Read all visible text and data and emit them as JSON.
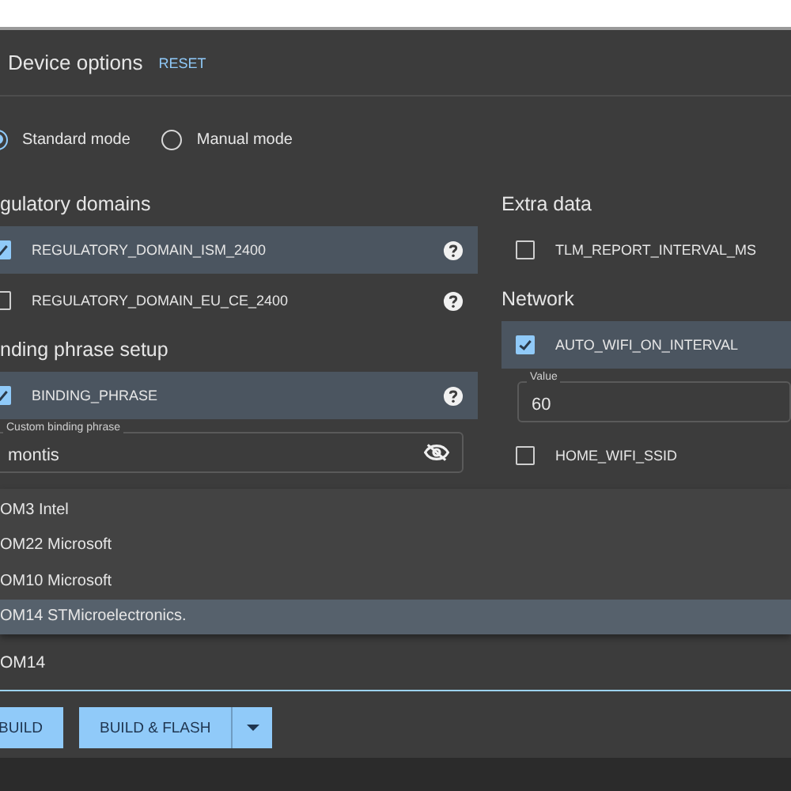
{
  "header": {
    "title": "Device options",
    "reset": "RESET"
  },
  "modes": [
    {
      "label": "Standard mode",
      "selected": true
    },
    {
      "label": "Manual mode",
      "selected": false
    }
  ],
  "left_sections": [
    {
      "heading": "gulatory domains",
      "items": [
        {
          "kind": "checkbox",
          "label": "REGULATORY_DOMAIN_ISM_2400",
          "checked": true,
          "help": true
        },
        {
          "kind": "checkbox",
          "label": "REGULATORY_DOMAIN_EU_CE_2400",
          "checked": false,
          "help": true
        }
      ]
    },
    {
      "heading": "nding phrase setup",
      "items": [
        {
          "kind": "checkbox",
          "label": "BINDING_PHRASE",
          "checked": true,
          "help": true
        },
        {
          "kind": "field",
          "label": "Custom binding phrase",
          "value": "montis",
          "reveal_toggle": true
        }
      ]
    }
  ],
  "right_sections": [
    {
      "heading": "Extra data",
      "items": [
        {
          "kind": "checkbox",
          "label": "TLM_REPORT_INTERVAL_MS",
          "checked": false,
          "help": false
        }
      ]
    },
    {
      "heading": "Network",
      "items": [
        {
          "kind": "checkbox",
          "label": "AUTO_WIFI_ON_INTERVAL",
          "checked": true,
          "help": false
        },
        {
          "kind": "field",
          "label": "Value",
          "value": "60",
          "reveal_toggle": false
        },
        {
          "kind": "checkbox",
          "label": "HOME_WIFI_SSID",
          "checked": false,
          "help": false
        }
      ]
    }
  ],
  "serial_menu": [
    {
      "label": "OM3 Intel",
      "selected": false
    },
    {
      "label": "OM22 Microsoft",
      "selected": false
    },
    {
      "label": "OM10 Microsoft",
      "selected": false
    },
    {
      "label": "OM14 STMicroelectronics.",
      "selected": true
    }
  ],
  "serial_select": {
    "value": "OM14"
  },
  "buttons": [
    {
      "label": "BUILD",
      "has_menu": false
    },
    {
      "label": "BUILD & FLASH",
      "has_menu": true
    }
  ]
}
